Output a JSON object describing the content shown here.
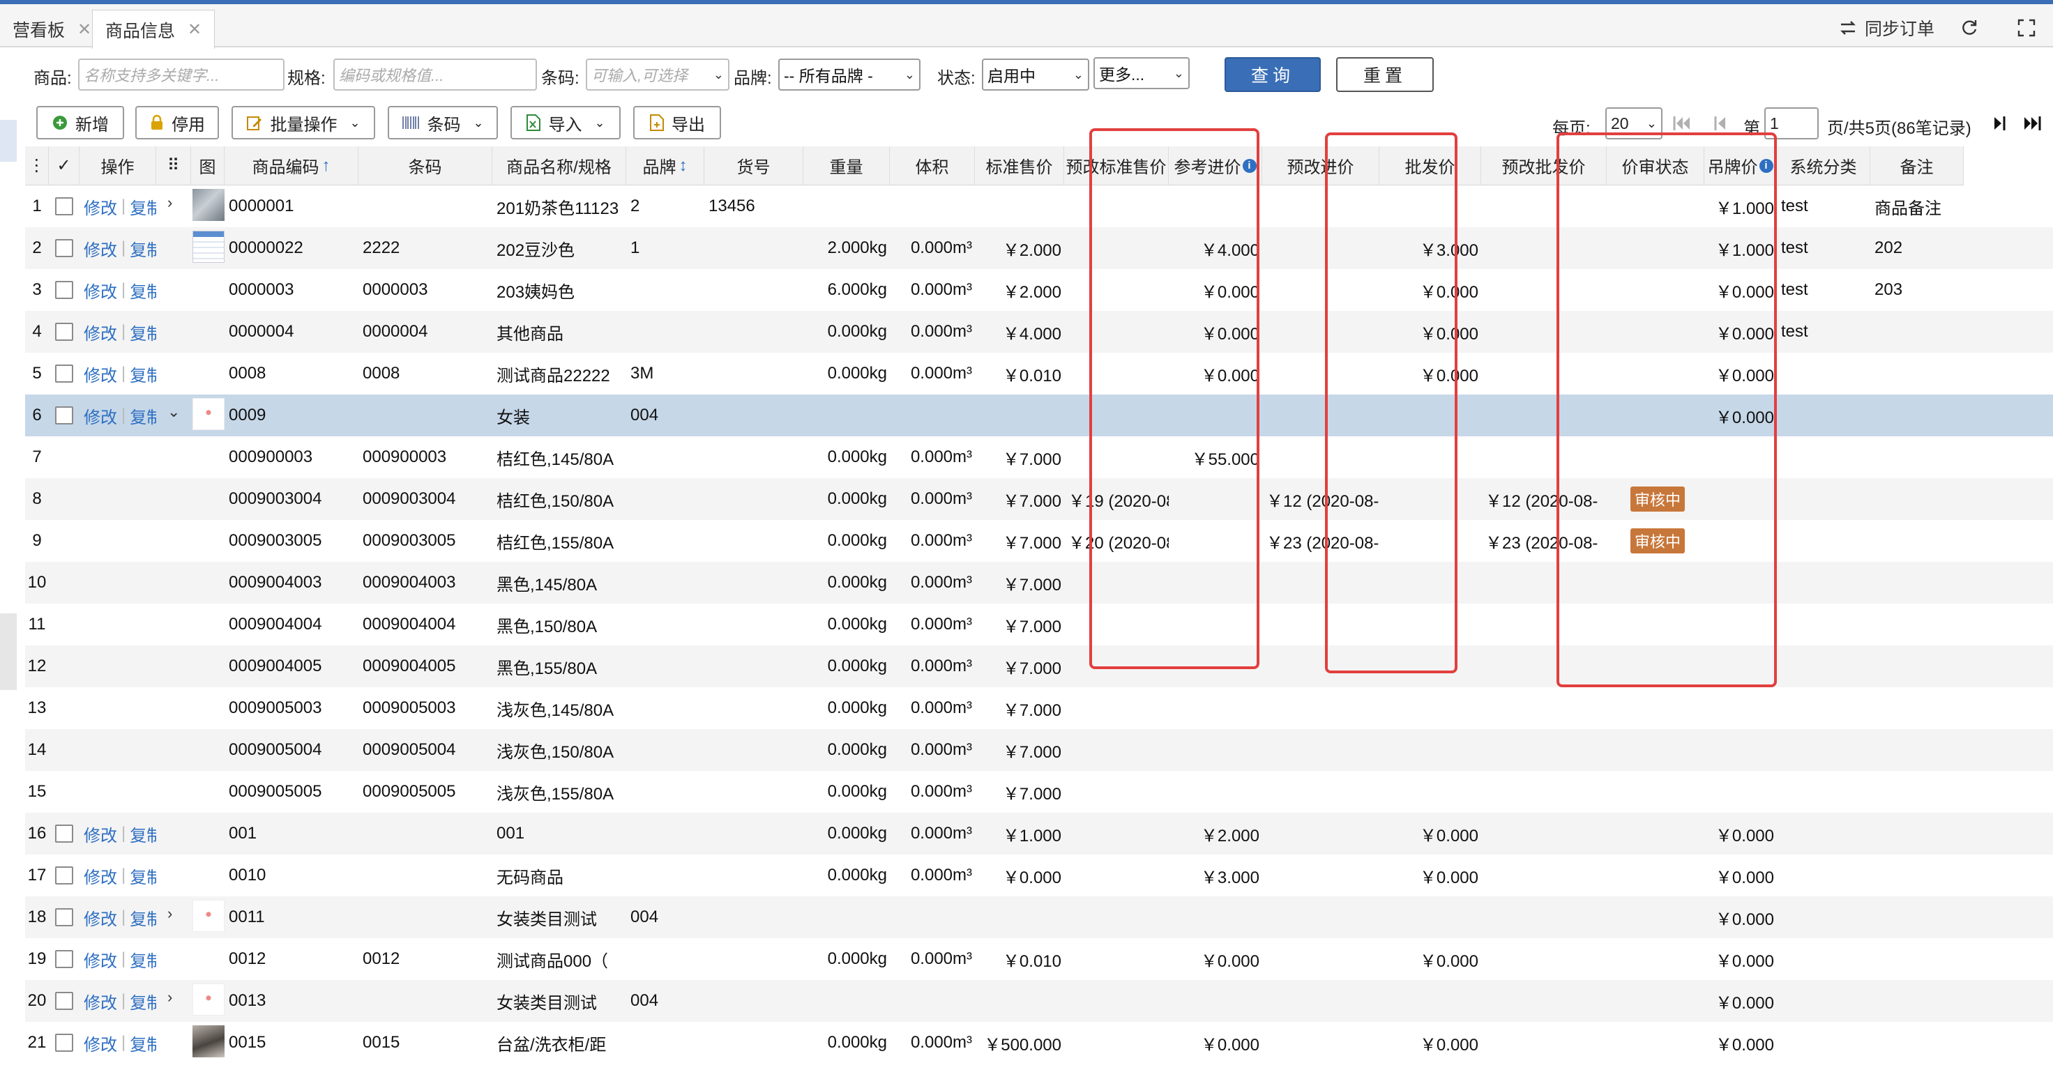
{
  "tabs": [
    {
      "label": "营看板",
      "close": "✕"
    },
    {
      "label": "商品信息",
      "close": "✕"
    }
  ],
  "top_actions": {
    "sync_label": "同步订单"
  },
  "filters": {
    "product_label": "商品:",
    "product_placeholder": "名称支持多关键字...",
    "spec_label": "规格:",
    "spec_placeholder": "编码或规格值...",
    "barcode_label": "条码:",
    "barcode_placeholder": "可输入,可选择",
    "brand_label": "品牌:",
    "brand_value": "-- 所有品牌 -",
    "status_label": "状态:",
    "status_value": "启用中",
    "more_label": "更多...",
    "query_label": "查询",
    "reset_label": "重置"
  },
  "toolbar": {
    "add": "新增",
    "disable": "停用",
    "batch": "批量操作",
    "barcode": "条码",
    "import": "导入",
    "export": "导出"
  },
  "pagination": {
    "per_page_label": "每页:",
    "per_page_value": "20",
    "page_prefix": "第",
    "page_value": "1",
    "page_suffix": "页/共5页(86笔记录)"
  },
  "table": {
    "headers": [
      "",
      "",
      "操作",
      "",
      "图",
      "商品编码",
      "条码",
      "商品名称/规格",
      "品牌",
      "货号",
      "重量",
      "体积",
      "标准售价",
      "预改标准售价",
      "参考进价",
      "预改进价",
      "批发价",
      "预改批发价",
      "价审状态",
      "吊牌价",
      "系统分类",
      "备注"
    ],
    "header_icons": {
      "col_menu": "⋮",
      "check": "✓",
      "drag": "⠿",
      "sort_up": "↑",
      "sort_both": "↕",
      "info": "i"
    },
    "action_edit": "修改",
    "action_copy": "复制",
    "action_sep": "|",
    "rows": [
      {
        "idx": "1",
        "code": "0000001",
        "barcode": "",
        "name": "201奶茶色11123",
        "brand": "2",
        "sku": "13456",
        "weight": "",
        "volume": "",
        "std": "",
        "pre_std": "",
        "ref": "",
        "pre_ref": "",
        "whole": "",
        "pre_whole": "",
        "audit": "",
        "tag": "￥1.000",
        "cat": "test",
        "note": "商品备注",
        "actions": true,
        "expand": "›",
        "thumb": "photo"
      },
      {
        "idx": "2",
        "code": "00000022",
        "barcode": "2222",
        "name": "202豆沙色",
        "brand": "1",
        "sku": "",
        "weight": "2.000kg",
        "volume": "0.000m³",
        "std": "￥2.000",
        "pre_std": "",
        "ref": "￥4.000",
        "pre_ref": "",
        "whole": "￥3.000",
        "pre_whole": "",
        "audit": "",
        "tag": "￥1.000",
        "cat": "test",
        "note": "202",
        "actions": true,
        "expand": "",
        "thumb": "doc"
      },
      {
        "idx": "3",
        "code": "0000003",
        "barcode": "0000003",
        "name": "203姨妈色",
        "brand": "",
        "sku": "",
        "weight": "6.000kg",
        "volume": "0.000m³",
        "std": "￥2.000",
        "pre_std": "",
        "ref": "￥0.000",
        "pre_ref": "",
        "whole": "￥0.000",
        "pre_whole": "",
        "audit": "",
        "tag": "￥0.000",
        "cat": "test",
        "note": "203",
        "actions": true,
        "expand": "",
        "thumb": ""
      },
      {
        "idx": "4",
        "code": "0000004",
        "barcode": "0000004",
        "name": "其他商品",
        "brand": "",
        "sku": "",
        "weight": "0.000kg",
        "volume": "0.000m³",
        "std": "￥4.000",
        "pre_std": "",
        "ref": "￥0.000",
        "pre_ref": "",
        "whole": "￥0.000",
        "pre_whole": "",
        "audit": "",
        "tag": "￥0.000",
        "cat": "test",
        "note": "",
        "actions": true,
        "expand": "",
        "thumb": ""
      },
      {
        "idx": "5",
        "code": "0008",
        "barcode": "0008",
        "name": "测试商品22222",
        "brand": "3M",
        "sku": "",
        "weight": "0.000kg",
        "volume": "0.000m³",
        "std": "￥0.010",
        "pre_std": "",
        "ref": "￥0.000",
        "pre_ref": "",
        "whole": "￥0.000",
        "pre_whole": "",
        "audit": "",
        "tag": "￥0.000",
        "cat": "",
        "note": "",
        "actions": true,
        "expand": "",
        "thumb": ""
      },
      {
        "idx": "6",
        "code": "0009",
        "barcode": "",
        "name": "女装",
        "brand": "004",
        "sku": "",
        "weight": "",
        "volume": "",
        "std": "",
        "pre_std": "",
        "ref": "",
        "pre_ref": "",
        "whole": "",
        "pre_whole": "",
        "audit": "",
        "tag": "￥0.000",
        "cat": "",
        "note": "",
        "actions": true,
        "expand": "⌄",
        "thumb": "red",
        "selected": true
      },
      {
        "idx": "7",
        "code": "000900003",
        "barcode": "000900003",
        "name": "桔红色,145/80A",
        "brand": "",
        "sku": "",
        "weight": "0.000kg",
        "volume": "0.000m³",
        "std": "￥7.000",
        "pre_std": "",
        "ref": "￥55.000",
        "pre_ref": "",
        "whole": "",
        "pre_whole": "",
        "audit": "",
        "tag": "",
        "cat": "",
        "note": "",
        "actions": false,
        "expand": "",
        "thumb": ""
      },
      {
        "idx": "8",
        "code": "0009003004",
        "barcode": "0009003004",
        "name": "桔红色,150/80A",
        "brand": "",
        "sku": "",
        "weight": "0.000kg",
        "volume": "0.000m³",
        "std": "￥7.000",
        "pre_std": "￥19 (2020-08-",
        "ref": "",
        "pre_ref": "￥12 (2020-08-",
        "whole": "",
        "pre_whole": "￥12 (2020-08-",
        "audit": "审核中",
        "tag": "",
        "cat": "",
        "note": "",
        "actions": false,
        "expand": "",
        "thumb": ""
      },
      {
        "idx": "9",
        "code": "0009003005",
        "barcode": "0009003005",
        "name": "桔红色,155/80A",
        "brand": "",
        "sku": "",
        "weight": "0.000kg",
        "volume": "0.000m³",
        "std": "￥7.000",
        "pre_std": "￥20 (2020-08-",
        "ref": "",
        "pre_ref": "￥23 (2020-08-",
        "whole": "",
        "pre_whole": "￥23 (2020-08-",
        "audit": "审核中",
        "tag": "",
        "cat": "",
        "note": "",
        "actions": false,
        "expand": "",
        "thumb": ""
      },
      {
        "idx": "10",
        "code": "0009004003",
        "barcode": "0009004003",
        "name": "黑色,145/80A",
        "brand": "",
        "sku": "",
        "weight": "0.000kg",
        "volume": "0.000m³",
        "std": "￥7.000",
        "pre_std": "",
        "ref": "",
        "pre_ref": "",
        "whole": "",
        "pre_whole": "",
        "audit": "",
        "tag": "",
        "cat": "",
        "note": "",
        "actions": false,
        "expand": "",
        "thumb": ""
      },
      {
        "idx": "11",
        "code": "0009004004",
        "barcode": "0009004004",
        "name": "黑色,150/80A",
        "brand": "",
        "sku": "",
        "weight": "0.000kg",
        "volume": "0.000m³",
        "std": "￥7.000",
        "pre_std": "",
        "ref": "",
        "pre_ref": "",
        "whole": "",
        "pre_whole": "",
        "audit": "",
        "tag": "",
        "cat": "",
        "note": "",
        "actions": false,
        "expand": "",
        "thumb": ""
      },
      {
        "idx": "12",
        "code": "0009004005",
        "barcode": "0009004005",
        "name": "黑色,155/80A",
        "brand": "",
        "sku": "",
        "weight": "0.000kg",
        "volume": "0.000m³",
        "std": "￥7.000",
        "pre_std": "",
        "ref": "",
        "pre_ref": "",
        "whole": "",
        "pre_whole": "",
        "audit": "",
        "tag": "",
        "cat": "",
        "note": "",
        "actions": false,
        "expand": "",
        "thumb": ""
      },
      {
        "idx": "13",
        "code": "0009005003",
        "barcode": "0009005003",
        "name": "浅灰色,145/80A",
        "brand": "",
        "sku": "",
        "weight": "0.000kg",
        "volume": "0.000m³",
        "std": "￥7.000",
        "pre_std": "",
        "ref": "",
        "pre_ref": "",
        "whole": "",
        "pre_whole": "",
        "audit": "",
        "tag": "",
        "cat": "",
        "note": "",
        "actions": false,
        "expand": "",
        "thumb": ""
      },
      {
        "idx": "14",
        "code": "0009005004",
        "barcode": "0009005004",
        "name": "浅灰色,150/80A",
        "brand": "",
        "sku": "",
        "weight": "0.000kg",
        "volume": "0.000m³",
        "std": "￥7.000",
        "pre_std": "",
        "ref": "",
        "pre_ref": "",
        "whole": "",
        "pre_whole": "",
        "audit": "",
        "tag": "",
        "cat": "",
        "note": "",
        "actions": false,
        "expand": "",
        "thumb": ""
      },
      {
        "idx": "15",
        "code": "0009005005",
        "barcode": "0009005005",
        "name": "浅灰色,155/80A",
        "brand": "",
        "sku": "",
        "weight": "0.000kg",
        "volume": "0.000m³",
        "std": "￥7.000",
        "pre_std": "",
        "ref": "",
        "pre_ref": "",
        "whole": "",
        "pre_whole": "",
        "audit": "",
        "tag": "",
        "cat": "",
        "note": "",
        "actions": false,
        "expand": "",
        "thumb": ""
      },
      {
        "idx": "16",
        "code": "001",
        "barcode": "",
        "name": "001",
        "brand": "",
        "sku": "",
        "weight": "0.000kg",
        "volume": "0.000m³",
        "std": "￥1.000",
        "pre_std": "",
        "ref": "￥2.000",
        "pre_ref": "",
        "whole": "￥0.000",
        "pre_whole": "",
        "audit": "",
        "tag": "￥0.000",
        "cat": "",
        "note": "",
        "actions": true,
        "expand": "",
        "thumb": ""
      },
      {
        "idx": "17",
        "code": "0010",
        "barcode": "",
        "name": "无码商品",
        "brand": "",
        "sku": "",
        "weight": "0.000kg",
        "volume": "0.000m³",
        "std": "￥0.000",
        "pre_std": "",
        "ref": "￥3.000",
        "pre_ref": "",
        "whole": "￥0.000",
        "pre_whole": "",
        "audit": "",
        "tag": "￥0.000",
        "cat": "",
        "note": "",
        "actions": true,
        "expand": "",
        "thumb": ""
      },
      {
        "idx": "18",
        "code": "0011",
        "barcode": "",
        "name": "女装类目测试",
        "brand": "004",
        "sku": "",
        "weight": "",
        "volume": "",
        "std": "",
        "pre_std": "",
        "ref": "",
        "pre_ref": "",
        "whole": "",
        "pre_whole": "",
        "audit": "",
        "tag": "￥0.000",
        "cat": "",
        "note": "",
        "actions": true,
        "expand": "›",
        "thumb": "red"
      },
      {
        "idx": "19",
        "code": "0012",
        "barcode": "0012",
        "name": "测试商品000（",
        "brand": "",
        "sku": "",
        "weight": "0.000kg",
        "volume": "0.000m³",
        "std": "￥0.010",
        "pre_std": "",
        "ref": "￥0.000",
        "pre_ref": "",
        "whole": "￥0.000",
        "pre_whole": "",
        "audit": "",
        "tag": "￥0.000",
        "cat": "",
        "note": "",
        "actions": true,
        "expand": "",
        "thumb": ""
      },
      {
        "idx": "20",
        "code": "0013",
        "barcode": "",
        "name": "女装类目测试",
        "brand": "004",
        "sku": "",
        "weight": "",
        "volume": "",
        "std": "",
        "pre_std": "",
        "ref": "",
        "pre_ref": "",
        "whole": "",
        "pre_whole": "",
        "audit": "",
        "tag": "￥0.000",
        "cat": "",
        "note": "",
        "actions": true,
        "expand": "›",
        "thumb": "red"
      },
      {
        "idx": "21",
        "code": "0015",
        "barcode": "0015",
        "name": "台盆/洗衣柜/距",
        "brand": "",
        "sku": "",
        "weight": "0.000kg",
        "volume": "0.000m³",
        "std": "￥500.000",
        "pre_std": "",
        "ref": "￥0.000",
        "pre_ref": "",
        "whole": "￥0.000",
        "pre_whole": "",
        "audit": "",
        "tag": "￥0.000",
        "cat": "",
        "note": "",
        "actions": true,
        "expand": "",
        "thumb": "dark"
      }
    ]
  },
  "colors": {
    "accent": "#2e6fc2",
    "primary_button": "#3a6fb7",
    "highlight_box": "#e23f3f",
    "audit_badge": "#c8773a",
    "selected_row": "#c6d7e8"
  }
}
